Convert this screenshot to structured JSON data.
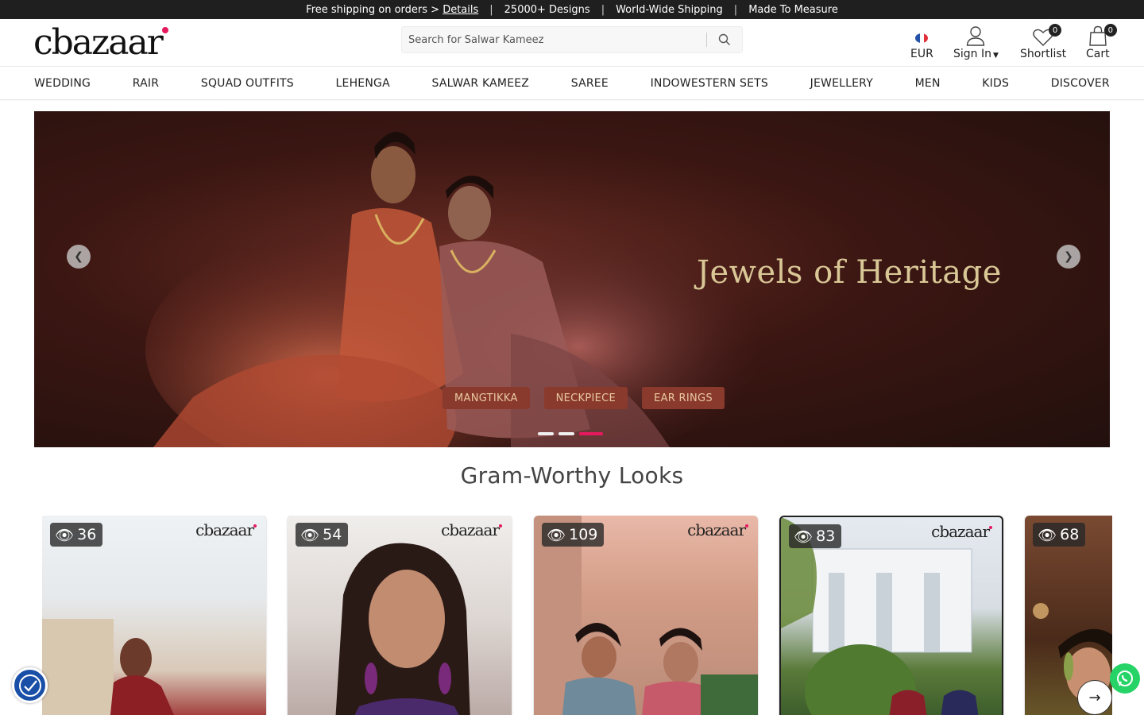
{
  "topbar": {
    "shipping_text": "Free shipping on orders >",
    "shipping_link": "Details",
    "designs": "25000+ Designs",
    "worldwide": "World-Wide Shipping",
    "measure": "Made To Measure",
    "separator": "|"
  },
  "header": {
    "logo_text": "cbazaar",
    "search_placeholder": "Search for Salwar Kameez",
    "currency": "EUR",
    "signin": "Sign In",
    "shortlist": "Shortlist",
    "shortlist_count": "0",
    "cart": "Cart",
    "cart_count": "0",
    "icons": {
      "search": "search-icon",
      "flag": "france-flag-icon",
      "user": "user-icon",
      "heart": "heart-icon",
      "bag": "shopping-bag-icon"
    }
  },
  "nav": {
    "items": [
      "WEDDING",
      "RAIR",
      "SQUAD OUTFITS",
      "LEHENGA",
      "SALWAR KAMEEZ",
      "SAREE",
      "INDOWESTERN SETS",
      "JEWELLERY",
      "MEN",
      "KIDS",
      "DISCOVER"
    ]
  },
  "hero": {
    "title": "Jewels of Heritage",
    "chips": [
      "MANGTIKKA",
      "NECKPIECE",
      "EAR RINGS"
    ],
    "active_slide": 3,
    "slide_count": 3,
    "colors": {
      "title": "#d9c796",
      "chip_bg": "#8a3a2c",
      "dot_active": "#e6195f"
    }
  },
  "section": {
    "title": "Gram-Worthy Looks"
  },
  "looks": [
    {
      "views": "36",
      "brand": "cbazaar"
    },
    {
      "views": "54",
      "brand": "cbazaar"
    },
    {
      "views": "109",
      "brand": "cbazaar"
    },
    {
      "views": "83",
      "brand": "cbazaar"
    },
    {
      "views": "68",
      "brand": ""
    }
  ],
  "floating": {
    "accessibility": "accessibility-icon",
    "whatsapp": "whatsapp-icon",
    "next": "arrow-right-icon"
  },
  "accent": "#e6195f"
}
